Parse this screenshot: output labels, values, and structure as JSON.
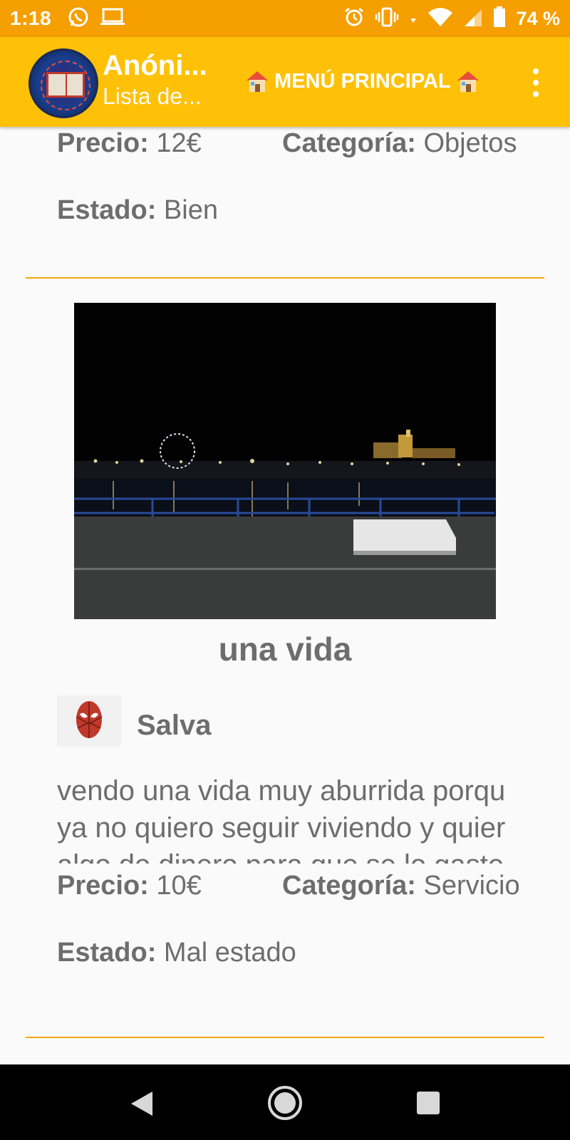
{
  "status_bar": {
    "time": "1:18",
    "battery": "74 %",
    "icons": [
      "whatsapp-icon",
      "laptop-icon",
      "alarm-icon",
      "vibrate-icon",
      "data-arrows-icon",
      "wifi-icon",
      "signal-icon",
      "battery-icon"
    ]
  },
  "app_bar": {
    "title": "Anóni...",
    "subtitle": "Lista de...",
    "menu_label": "MENÚ PRINCIPAL"
  },
  "labels": {
    "price": "Precio:",
    "category": "Categoría:",
    "state": "Estado:"
  },
  "items": [
    {
      "price": "12€",
      "category": "Objetos",
      "state": "Bien"
    },
    {
      "title": "una vida",
      "seller": "Salva",
      "description_lines": [
        "vendo una vida muy aburrida porqu",
        "ya no quiero seguir viviendo y quier",
        "algo de dinero para que se lo gaste"
      ],
      "price": "10€",
      "category": "Servicio",
      "state": "Mal estado"
    }
  ],
  "colors": {
    "status_bar": "#f59f00",
    "app_bar": "#ffc107",
    "divider": "#f3a712",
    "text": "#6d6d6d"
  }
}
